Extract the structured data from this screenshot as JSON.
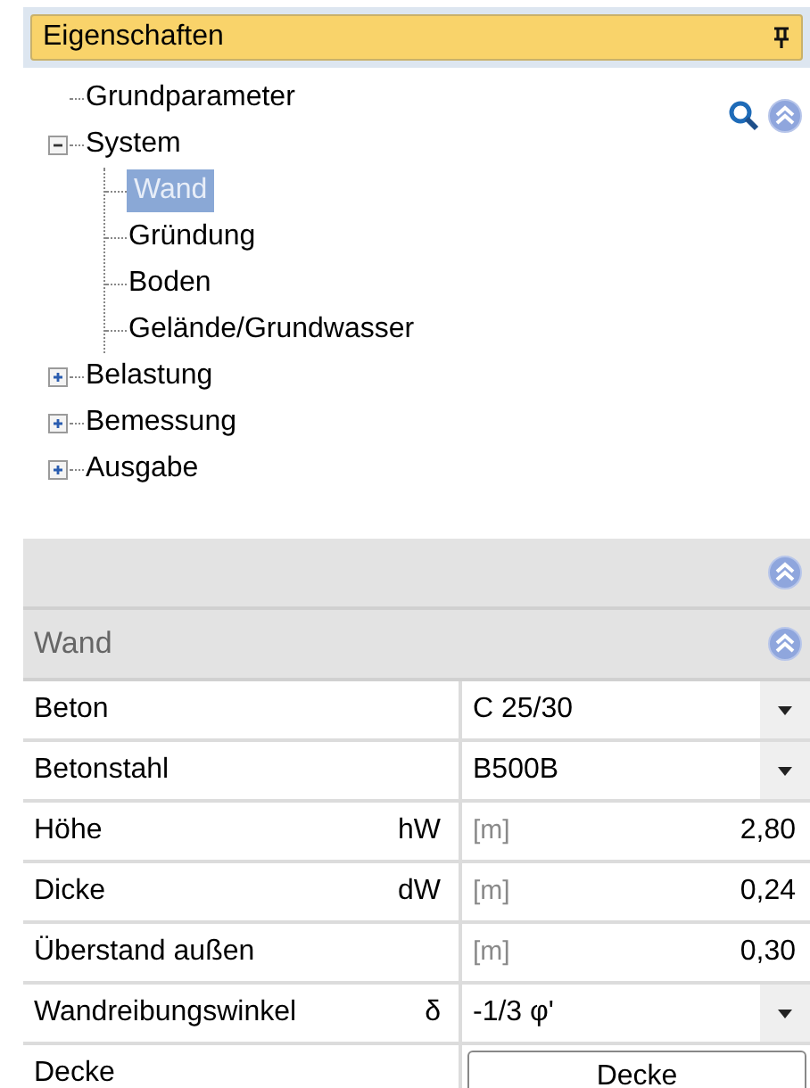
{
  "panel": {
    "title": "Eigenschaften"
  },
  "tree": [
    {
      "label": "Grundparameter",
      "selected": false
    },
    {
      "label": "System",
      "selected": false,
      "expanded": true,
      "children": [
        {
          "label": "Wand",
          "selected": true
        },
        {
          "label": "Gründung",
          "selected": false
        },
        {
          "label": "Boden",
          "selected": false
        },
        {
          "label": "Gelände/Grundwasser",
          "selected": false
        }
      ]
    },
    {
      "label": "Belastung",
      "selected": false,
      "expanded": false
    },
    {
      "label": "Bemessung",
      "selected": false,
      "expanded": false
    },
    {
      "label": "Ausgabe",
      "selected": false,
      "expanded": false
    }
  ],
  "grid": {
    "section": "Wand",
    "rows": [
      {
        "kind": "combo",
        "label": "Beton",
        "value": "C 25/30"
      },
      {
        "kind": "combo",
        "label": "Betonstahl",
        "value": "B500B"
      },
      {
        "kind": "number",
        "label": "Höhe",
        "symbol": "hW",
        "unit": "[m]",
        "value": "2,80"
      },
      {
        "kind": "number",
        "label": "Dicke",
        "symbol": "dW",
        "unit": "[m]",
        "value": "0,24"
      },
      {
        "kind": "number",
        "label": "Überstand außen",
        "unit": "[m]",
        "value": "0,30"
      },
      {
        "kind": "combo",
        "label": "Wandreibungswinkel",
        "symbol": "δ",
        "value": "-1/3 φ'"
      },
      {
        "kind": "button",
        "label": "Decke",
        "value": "Decke"
      }
    ]
  }
}
